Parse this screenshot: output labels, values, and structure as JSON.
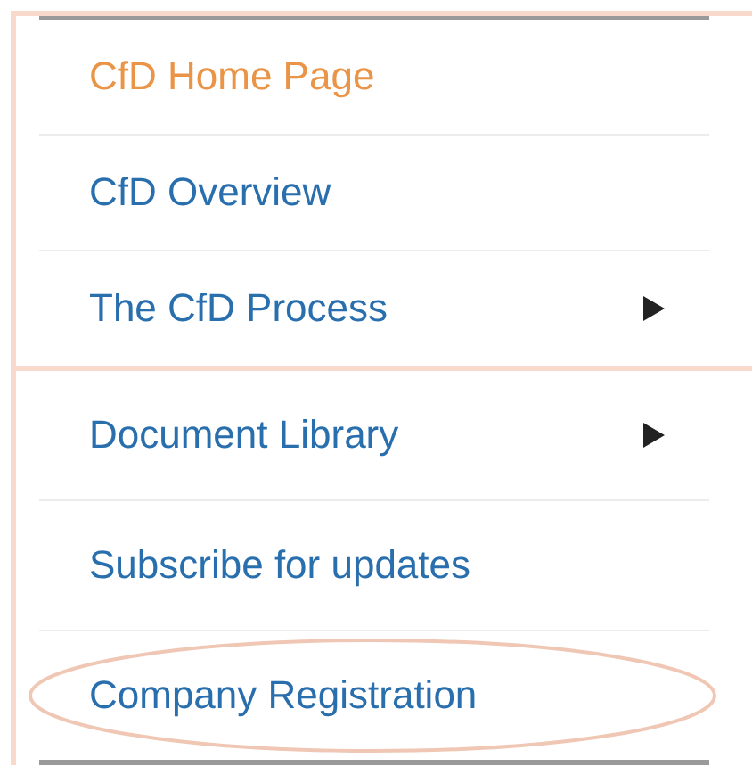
{
  "menu_groups": [
    {
      "items": [
        {
          "label": "CfD Home Page",
          "selected": true,
          "has_submenu": false,
          "circled": false
        },
        {
          "label": "CfD Overview",
          "selected": false,
          "has_submenu": false,
          "circled": false
        },
        {
          "label": "The CfD Process",
          "selected": false,
          "has_submenu": true,
          "circled": false
        }
      ]
    },
    {
      "items": [
        {
          "label": "Document Library",
          "selected": false,
          "has_submenu": true,
          "circled": false
        },
        {
          "label": "Subscribe for updates",
          "selected": false,
          "has_submenu": false,
          "circled": false
        },
        {
          "label": "Company Registration",
          "selected": false,
          "has_submenu": false,
          "circled": true
        }
      ]
    }
  ]
}
